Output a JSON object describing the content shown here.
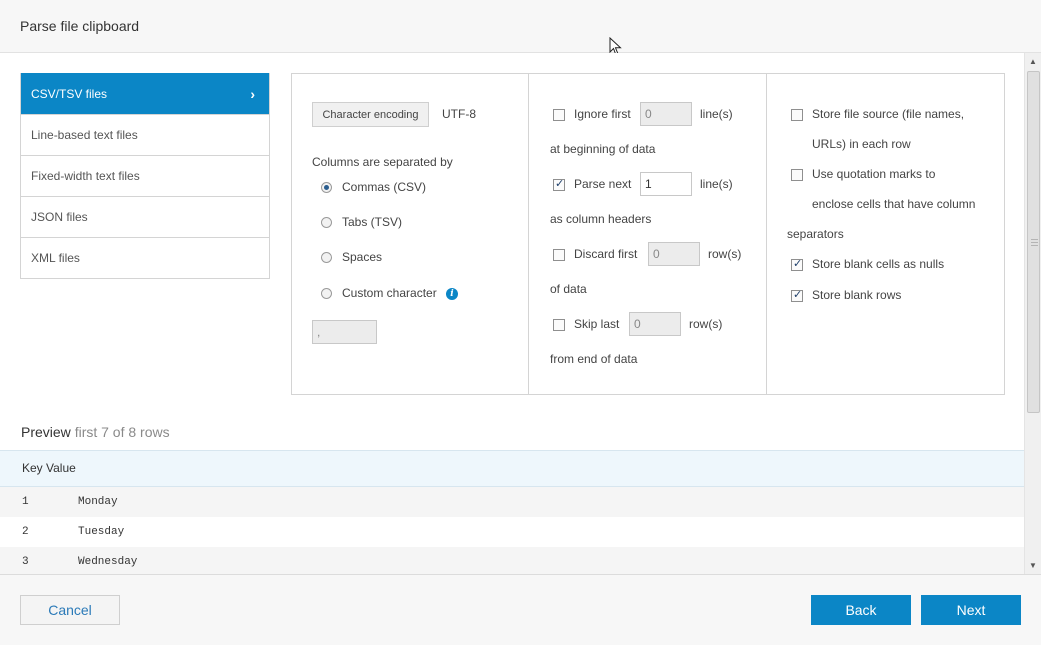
{
  "header": {
    "title": "Parse file  clipboard"
  },
  "nav": {
    "items": [
      {
        "label": "CSV/TSV files",
        "active": true
      },
      {
        "label": "Line-based text files",
        "active": false
      },
      {
        "label": "Fixed-width text files",
        "active": false
      },
      {
        "label": "JSON files",
        "active": false
      },
      {
        "label": "XML files",
        "active": false
      }
    ]
  },
  "encoding": {
    "button_label": "Character encoding",
    "value": "UTF-8"
  },
  "separator": {
    "heading": "Columns are separated by",
    "options": [
      {
        "label": "Commas (CSV)",
        "selected": true
      },
      {
        "label": "Tabs (TSV)",
        "selected": false
      },
      {
        "label": "Spaces",
        "selected": false
      },
      {
        "label": "Custom character",
        "selected": false
      }
    ],
    "custom_value": ","
  },
  "rows": {
    "ignore_first": {
      "label": "Ignore first",
      "checked": false,
      "value": "0",
      "unit": "line(s)",
      "suffix": "at beginning of data"
    },
    "parse_next": {
      "label": "Parse next",
      "checked": true,
      "value": "1",
      "unit": "line(s)",
      "suffix": "as column headers"
    },
    "discard_first": {
      "label": "Discard first",
      "checked": false,
      "value": "0",
      "unit": "row(s)",
      "suffix": "of data"
    },
    "skip_last": {
      "label": "Skip last",
      "checked": false,
      "value": "0",
      "unit": "row(s)",
      "suffix": "from end of data"
    }
  },
  "store": {
    "file_source": {
      "line1": "Store file source (file names,",
      "line2": "URLs) in each row",
      "checked": false
    },
    "quotation": {
      "line1": "Use quotation marks to",
      "line2": "enclose cells that have column",
      "line3": "separators",
      "checked": false
    },
    "blank_nulls": {
      "label": "Store blank cells as nulls",
      "checked": true
    },
    "blank_rows": {
      "label": "Store blank rows",
      "checked": true
    }
  },
  "preview": {
    "label": "Preview",
    "sub": "first 7 of 8 rows",
    "header": "Key Value",
    "rows": [
      {
        "key": "1",
        "value": "Monday"
      },
      {
        "key": "2",
        "value": "Tuesday"
      },
      {
        "key": "3",
        "value": "Wednesday"
      }
    ]
  },
  "footer": {
    "cancel": "Cancel",
    "back": "Back",
    "next": "Next"
  },
  "colors": {
    "accent": "#0b86c6",
    "table_header_bg": "#eef7fc"
  }
}
